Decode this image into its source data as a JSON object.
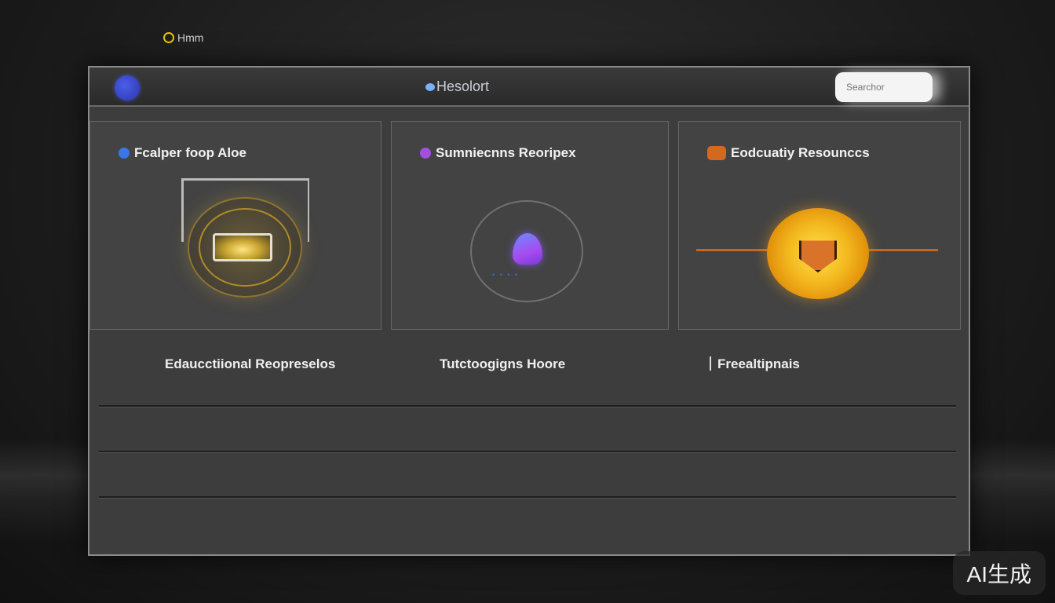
{
  "top": {
    "label": "Hmm"
  },
  "window": {
    "title": "Hesolort",
    "search": {
      "placeholder": "Searchor"
    }
  },
  "cards": [
    {
      "title": "Fcalper foop Aloe",
      "accent": "#3a76e8",
      "icon": "lamp-icon"
    },
    {
      "title": "Sumniecnns Reoripex",
      "accent": "#a24fe0",
      "icon": "flame-icon"
    },
    {
      "title": "Eodcuatiy Resounccs",
      "accent": "#d2691e",
      "icon": "shield-icon"
    }
  ],
  "labels": [
    "Edaucctiional Reopreselos",
    "Tutctoogigns Hoore",
    "Freealtipnais"
  ],
  "watermark": "AI生成",
  "colors": {
    "avatar": "#3848d0",
    "coin": "#f3b61d",
    "divider": "#c9651a"
  }
}
